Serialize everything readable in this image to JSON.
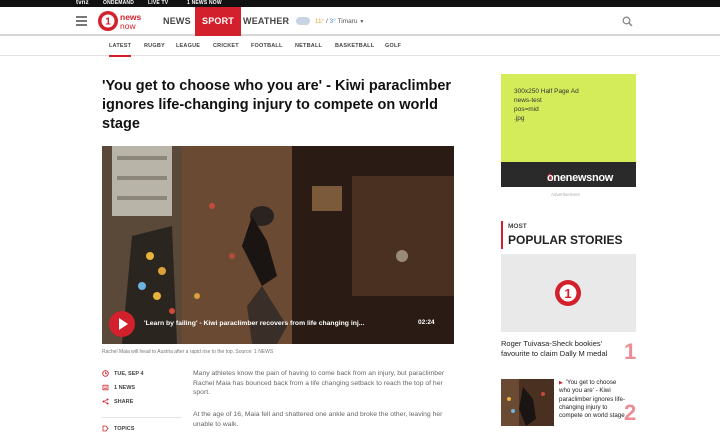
{
  "topbar": {
    "brand": "tvnz",
    "links": [
      "ONDEMAND",
      "LIVE TV",
      "1 NEWS NOW"
    ]
  },
  "nav": {
    "logo_text": "news now",
    "items": [
      "NEWS",
      "SPORT",
      "WEATHER"
    ],
    "active": "SPORT",
    "weather": {
      "high": "11°",
      "separator": "/",
      "low": "3°",
      "location": "Timaru"
    }
  },
  "subnav": {
    "items": [
      "LATEST",
      "RUGBY",
      "LEAGUE",
      "CRICKET",
      "FOOTBALL",
      "NETBALL",
      "BASKETBALL",
      "GOLF"
    ],
    "active": "LATEST"
  },
  "article": {
    "headline": "'You get to choose who you are' - Kiwi paraclimber ignores life-changing injury to compete on world stage",
    "video": {
      "title": "'Learn by failing' - Kiwi paraclimber recovers from life changing inj...",
      "duration": "02:24"
    },
    "photo_caption": "Rachel Maia will head to Austria after a rapid rise to the top. Source: 1 NEWS",
    "meta": {
      "date": "TUE, SEP 4",
      "source": "1 NEWS",
      "share": "SHARE",
      "topics": "TOPICS"
    },
    "paragraphs": [
      "Many athletes know the pain of having to come back from an injury, but paraclimber Rachel Maia has bounced back from a life changing setback to reach the top of her sport.",
      "At the age of 16, Maia fell and shattered one ankle and broke the other, leaving her unable to walk."
    ]
  },
  "ad": {
    "lines": [
      "300x250 Half Page Ad",
      "news-test",
      "pos=mid",
      ".jpg"
    ],
    "logo_text": "onenewsnow",
    "logo_prefix": "1",
    "label": "Advertisement"
  },
  "popular": {
    "kicker": "MOST",
    "title": "POPULAR STORIES",
    "stories": [
      {
        "rank": "1",
        "title": "Roger Tuivasa-Sheck bookies' favourite to claim Dally M medal"
      },
      {
        "rank": "2",
        "title": "'You get to choose who you are' - Kiwi paraclimber ignores life-changing injury to compete on world stage"
      }
    ]
  },
  "colors": {
    "accent": "#d2202c",
    "ad_bg": "#d4ec59"
  }
}
